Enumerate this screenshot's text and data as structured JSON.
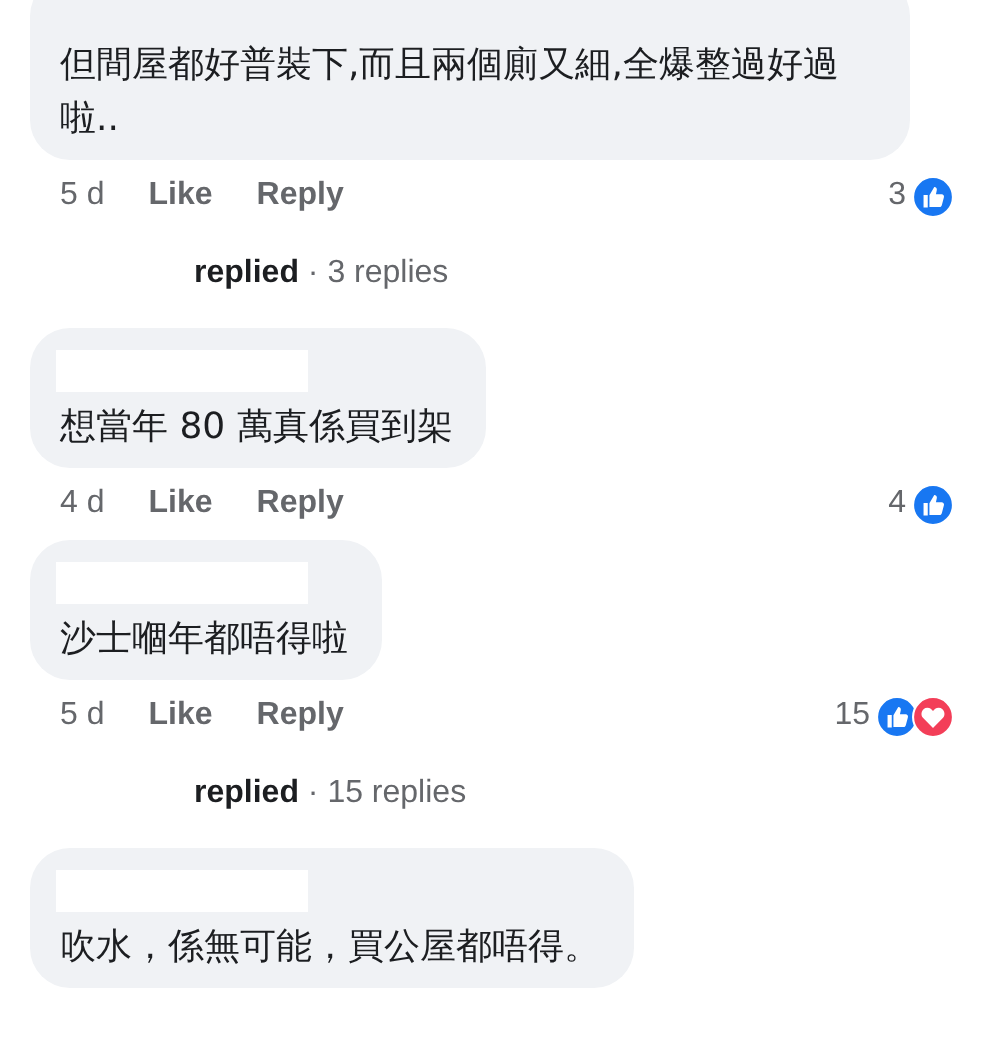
{
  "items": [
    {
      "kind": "comment",
      "name_redacted": false,
      "text": "但間屋都好普裝下,而且兩個廁又細,全爆整過好過啦..",
      "time": "5 d",
      "like": "Like",
      "reply": "Reply",
      "reaction_count": "3",
      "reactions": [
        {
          "kind": "like"
        }
      ]
    },
    {
      "kind": "replies",
      "who": "replied",
      "count": "· 3 replies"
    },
    {
      "kind": "comment",
      "name_redacted": true,
      "text": "想當年 80 萬真係買到架",
      "time": "4 d",
      "like": "Like",
      "reply": "Reply",
      "reaction_count": "4",
      "reactions": [
        {
          "kind": "like"
        }
      ]
    },
    {
      "kind": "comment",
      "name_redacted": true,
      "text": "沙士嗰年都唔得啦",
      "time": "5 d",
      "like": "Like",
      "reply": "Reply",
      "reaction_count": "15",
      "reactions": [
        {
          "kind": "like"
        },
        {
          "kind": "love"
        }
      ]
    },
    {
      "kind": "replies",
      "who": "replied",
      "count": "· 15 replies"
    },
    {
      "kind": "comment",
      "name_redacted": true,
      "text": "吹水，係無可能，買公屋都唔得。"
    }
  ]
}
